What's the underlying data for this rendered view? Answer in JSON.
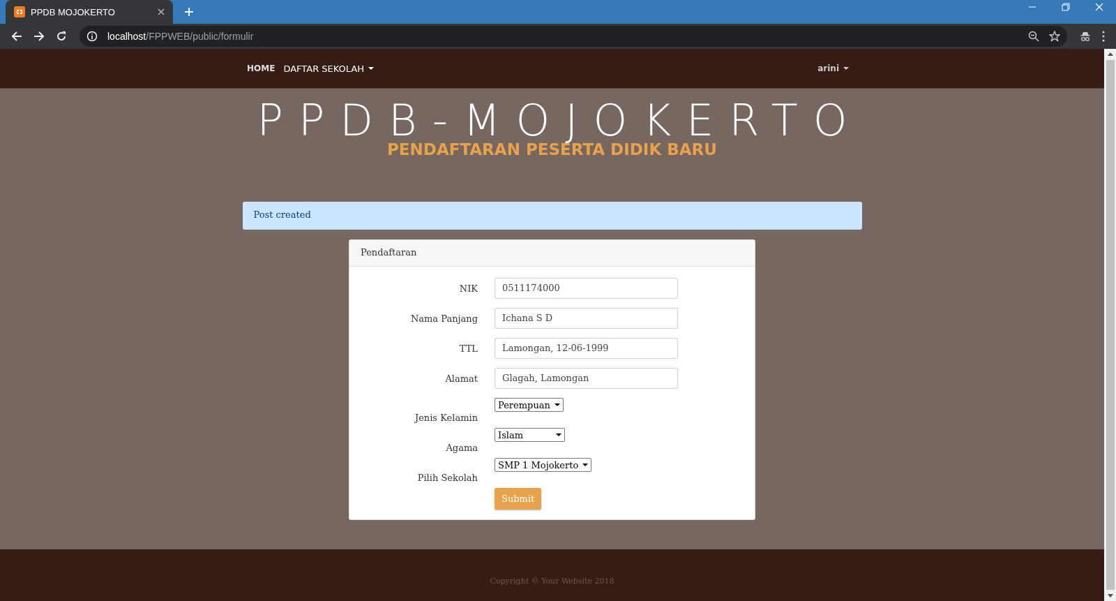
{
  "browser": {
    "tab_title": "PPDB MOJOKERTO",
    "url_host": "localhost",
    "url_path": "/FPPWEB/public/formulir"
  },
  "navbar": {
    "items": [
      {
        "label": "HOME",
        "kind": "link"
      },
      {
        "label": "DAFTAR SEKOLAH",
        "kind": "dropdown"
      }
    ],
    "user": "arini"
  },
  "header": {
    "title": "PPDB-MOJOKERTO",
    "subtitle": "PENDAFTARAN PESERTA DIDIK BARU"
  },
  "alert": "Post created",
  "form": {
    "title": "Pendaftaran",
    "fields": [
      {
        "label": "NIK",
        "kind": "text",
        "value": "0511174000"
      },
      {
        "label": "Nama Panjang",
        "kind": "text",
        "value": "Ichana S D"
      },
      {
        "label": "TTL",
        "kind": "text",
        "value": "Lamongan, 12-06-1999"
      },
      {
        "label": "Alamat",
        "kind": "text",
        "value": "Glagah, Lamongan"
      },
      {
        "label": "Jenis Kelamin",
        "kind": "select",
        "value": "Perempuan"
      },
      {
        "label": "Agama",
        "kind": "select",
        "value": "Islam"
      },
      {
        "label": "Pilih Sekolah",
        "kind": "select",
        "value": "SMP 1 Mojokerto"
      }
    ],
    "submit": "Submit"
  },
  "footer": "Copyright © Your Website 2018"
}
